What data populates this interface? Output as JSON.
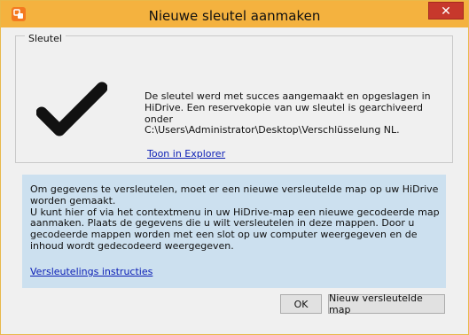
{
  "window": {
    "title": "Nieuwe sleutel aanmaken",
    "close_label": "✕"
  },
  "key_group": {
    "label": "Sleutel",
    "icon": "checkmark-icon",
    "message_lines": [
      "De sleutel werd met succes aangemaakt en opgeslagen in",
      "HiDrive. Een reservekopie van uw sleutel is gearchiveerd onder",
      "C:\\Users\\Administrator\\Desktop\\Verschlüsselung NL."
    ],
    "show_in_explorer_link": "Toon in Explorer"
  },
  "info": {
    "paragraph1": "Om gegevens te versleutelen, moet er een nieuwe versleutelde map op uw HiDrive worden gemaakt.",
    "paragraph2": "U kunt hier of via het contextmenu in uw HiDrive-map een nieuwe gecodeerde map aanmaken. Plaats de gegevens die u wilt versleutelen in deze mappen. Door u gecodeerde mappen worden met een slot op uw computer weergegeven en de inhoud wordt gedecodeerd weergegeven.",
    "instructions_link": "Versleutelings instructies"
  },
  "buttons": {
    "ok": "OK",
    "new_folder": "Nieuw versleutelde map"
  },
  "colors": {
    "titlebar": "#f4b23f",
    "info_panel": "#cce0ef",
    "link": "#0a1db5",
    "close": "#c7382c"
  }
}
